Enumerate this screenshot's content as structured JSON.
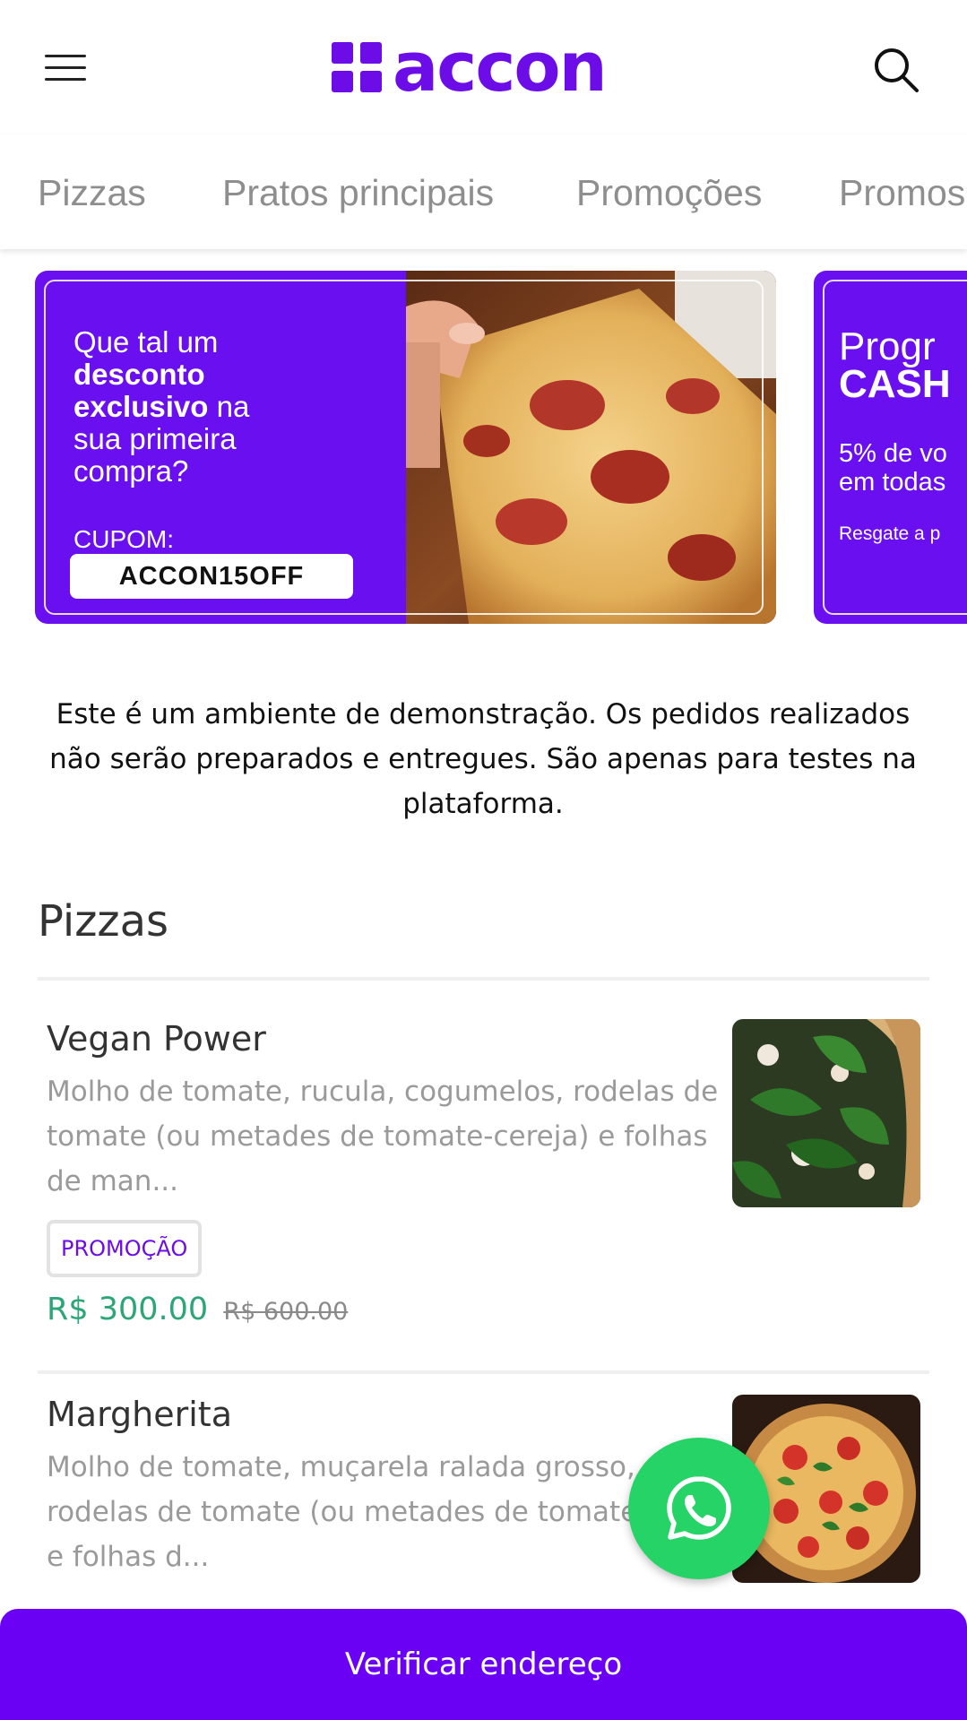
{
  "header": {
    "logo_text": "accon",
    "menu_icon": "hamburger-menu-icon",
    "search_icon": "search-icon",
    "brand_color": "#6c0ce6"
  },
  "tabs": [
    {
      "label": "Pizzas"
    },
    {
      "label": "Pratos principais"
    },
    {
      "label": "Promoções"
    },
    {
      "label": "Promos"
    }
  ],
  "banners": [
    {
      "line1": "Que tal um",
      "bold1": "desconto",
      "bold2": "exclusivo",
      "line3_rest": " na",
      "line4": "sua primeira",
      "line5": "compra?",
      "coupon_label": "CUPOM:",
      "coupon_code": "ACCON15OFF"
    },
    {
      "title": "Progr",
      "title_bold": "CASH",
      "subtitle_1": "5% de vo",
      "subtitle_2": "em todas",
      "small": "Resgate a p"
    }
  ],
  "notice": "Este é um ambiente de demonstração. Os pedidos realizados não serão preparados e entregues. São apenas para testes na plataforma.",
  "section": {
    "title": "Pizzas"
  },
  "products": [
    {
      "name": "Vegan Power",
      "description": "Molho de tomate, rucula, cogumelos, rodelas de tomate (ou metades de tomate-cereja) e folhas de man...",
      "badge": "PROMOÇÃO",
      "price": "R$ 300.00",
      "old_price": "R$ 600.00"
    },
    {
      "name": "Margherita",
      "description": "Molho de tomate, muçarela ralada grosso, rodelas de tomate (ou metades de tomate-cereja) e folhas d..."
    }
  ],
  "whatsapp": {
    "icon": "whatsapp-icon",
    "color": "#25d366"
  },
  "bottom_bar": {
    "label": "Verificar endereço",
    "color": "#6a00f4"
  }
}
